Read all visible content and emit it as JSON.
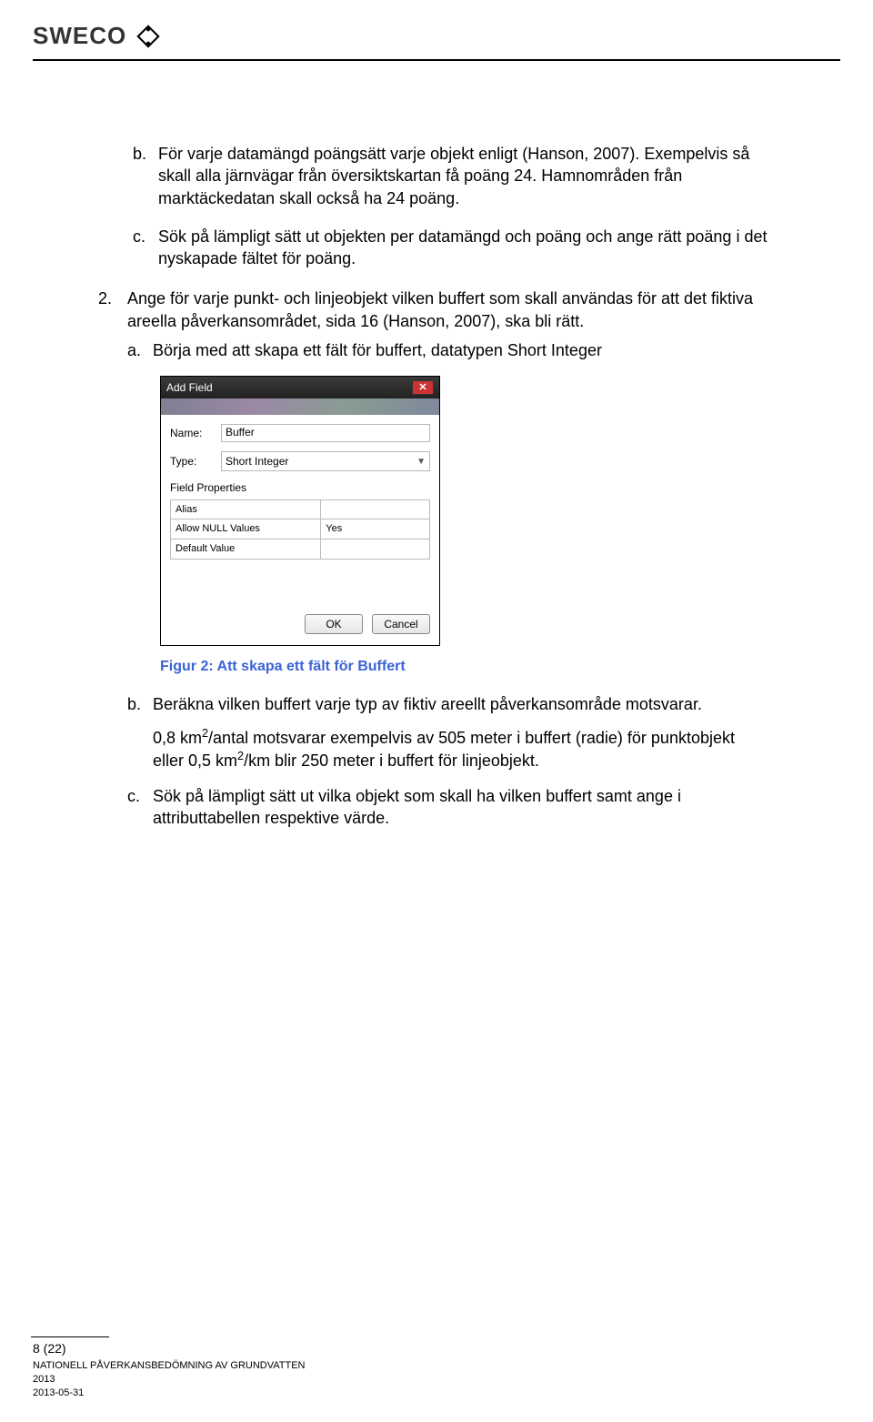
{
  "logo": {
    "text": "SWECO"
  },
  "items": {
    "b": {
      "text": "För varje datamängd poängsätt varje objekt enligt (Hanson, 2007). Exempelvis så skall alla järnvägar från översiktskartan få poäng 24. Hamnområden från marktäckedatan skall också ha 24 poäng."
    },
    "c": {
      "text": "Sök på lämpligt sätt ut objekten per datamängd och poäng och ange rätt poäng i det nyskapade fältet för poäng."
    }
  },
  "step2": {
    "text": "Ange för varje punkt- och linjeobjekt vilken buffert som skall användas för att det fiktiva areella påverkansområdet, sida 16 (Hanson, 2007), ska bli rätt.",
    "a": {
      "text": "Börja med att skapa ett fält för buffert, datatypen Short Integer"
    },
    "b": {
      "text": "Beräkna vilken buffert varje typ av fiktiv areellt påverkansområde motsvarar."
    },
    "c": {
      "text": "Sök på lämpligt sätt ut vilka objekt som skall ha vilken buffert samt ange i attributtabellen respektive värde."
    },
    "calc": {
      "l1_pre": "0,8 km",
      "l1_post": "/antal motsvarar exempelvis av 505 meter i buffert (radie) för punktobjekt",
      "l2_pre": "eller 0,5 km",
      "l2_post": "/km blir 250 meter i buffert för linjeobjekt."
    }
  },
  "dialog": {
    "title": "Add Field",
    "name_label": "Name:",
    "name_value": "Buffer",
    "type_label": "Type:",
    "type_value": "Short Integer",
    "fp_label": "Field Properties",
    "rows": [
      {
        "k": "Alias",
        "v": ""
      },
      {
        "k": "Allow NULL Values",
        "v": "Yes"
      },
      {
        "k": "Default Value",
        "v": ""
      }
    ],
    "ok": "OK",
    "cancel": "Cancel"
  },
  "figure_caption": "Figur 2: Att skapa ett fält för Buffert",
  "footer": {
    "pageno": "8 (22)",
    "l1": "NATIONELL PÅVERKANSBEDÖMNING AV GRUNDVATTEN",
    "l2": "2013",
    "l3": "2013-05-31"
  },
  "markers": {
    "b": "b.",
    "c": "c.",
    "n2": "2.",
    "a": "a."
  },
  "sup2": "2"
}
